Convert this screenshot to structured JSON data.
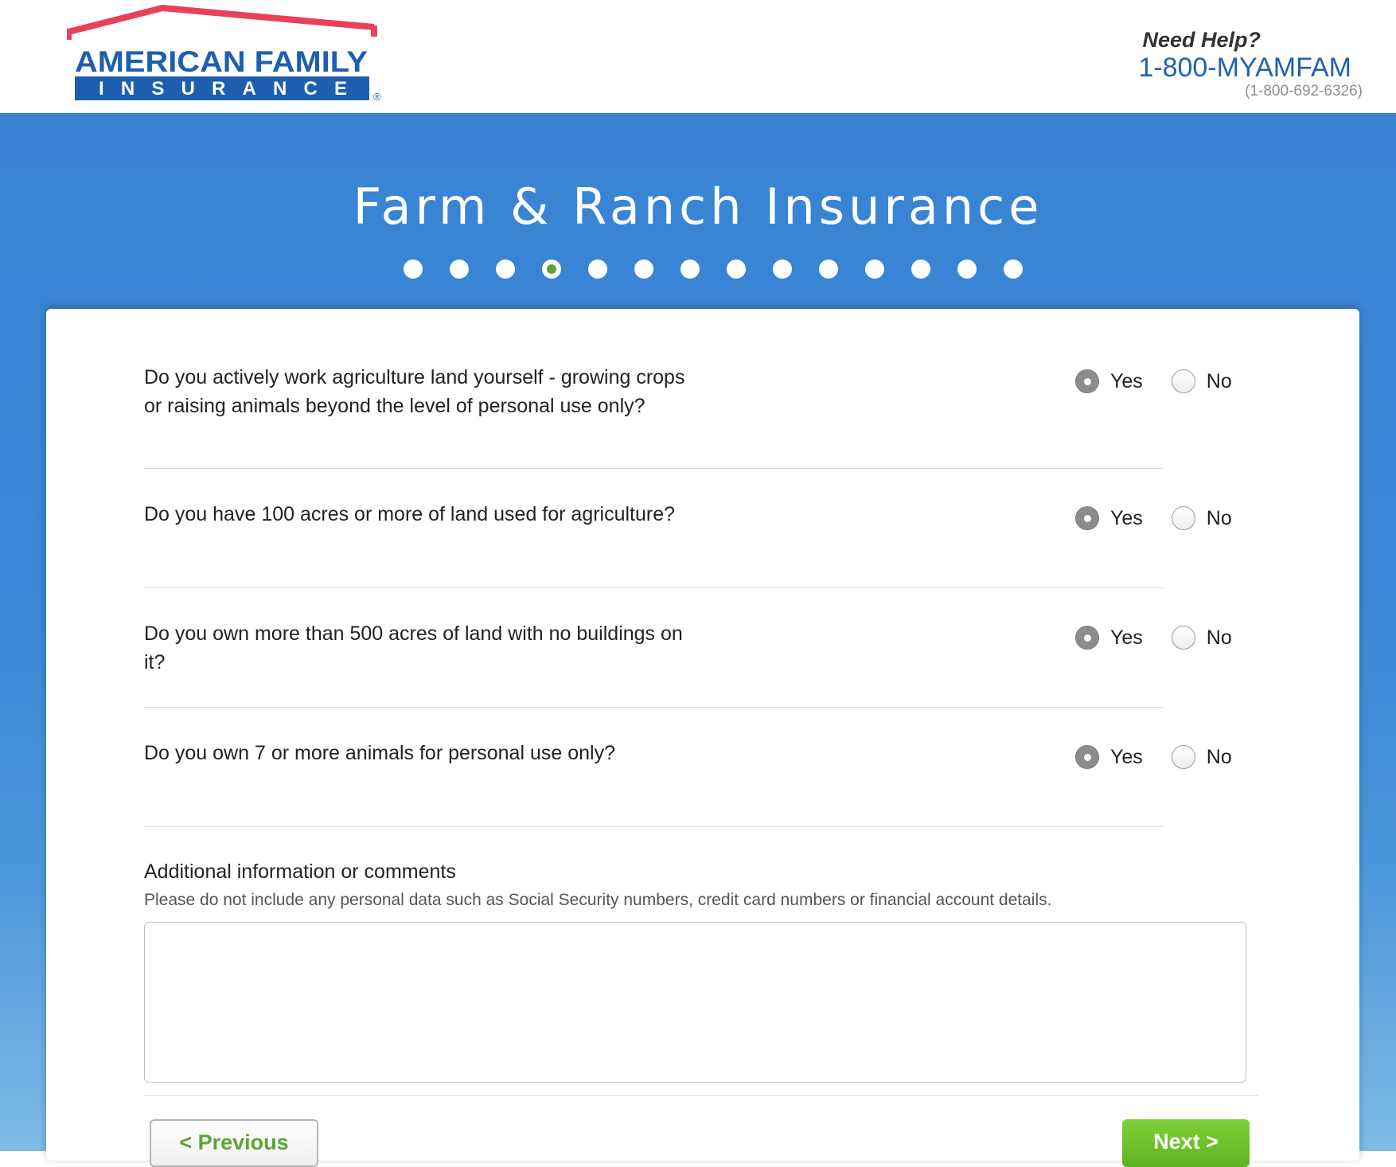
{
  "brand": {
    "logo_line1": "AMERICAN FAMILY",
    "logo_line2": "INSURANCE",
    "logo_mark": "®",
    "colors": {
      "roof": "#e8425a",
      "brand_blue": "#1d5fae",
      "band_blue": "#3b86d6",
      "accent_green": "#5aa437"
    }
  },
  "help": {
    "title": "Need Help?",
    "phone": "1-800-MYAMFAM",
    "number": "(1-800-692-6326)"
  },
  "page": {
    "title": "Farm & Ranch Insurance",
    "steps_total": 14,
    "current_step": 4
  },
  "questions": [
    {
      "text": "Do you actively work agriculture land yourself - growing crops or raising animals beyond the level of personal use only?",
      "yes_label": "Yes",
      "no_label": "No",
      "selected": "Yes"
    },
    {
      "text": "Do you have 100 acres or more of land used for agriculture?",
      "yes_label": "Yes",
      "no_label": "No",
      "selected": "Yes"
    },
    {
      "text": "Do you own more than 500 acres of land with no buildings on it?",
      "yes_label": "Yes",
      "no_label": "No",
      "selected": "Yes"
    },
    {
      "text": "Do you own 7 or more animals for personal use only?",
      "yes_label": "Yes",
      "no_label": "No",
      "selected": "Yes"
    }
  ],
  "comments": {
    "title": "Additional information or comments",
    "note": "Please do not include any personal data such as Social Security numbers, credit card numbers or financial account details.",
    "value": ""
  },
  "nav": {
    "previous_label": "< Previous",
    "next_label": "Next >"
  }
}
